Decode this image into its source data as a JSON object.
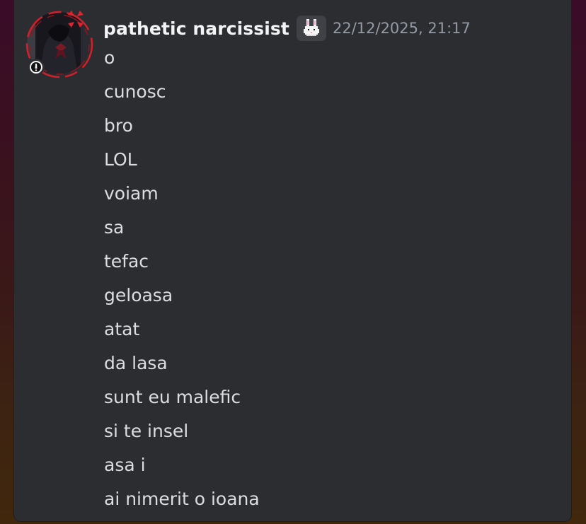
{
  "message": {
    "author": "pathetic narcissist",
    "role_icon": "bunny-pixel-icon",
    "timestamp": "22/12/2025, 21:17",
    "lines": [
      "o",
      "cunosc",
      "bro",
      "LOL",
      "voiam",
      "sa",
      "tefac",
      "geloasa",
      "atat",
      "da lasa",
      "sunt eu malefic",
      "si te insel",
      "asa i",
      "ai nimerit o ioana"
    ]
  },
  "colors": {
    "card_background": "#2c2d31",
    "username": "#f2f3f5",
    "message_text": "#dbdee1",
    "timestamp": "#949ba4",
    "decoration_red": "#d3202a"
  }
}
